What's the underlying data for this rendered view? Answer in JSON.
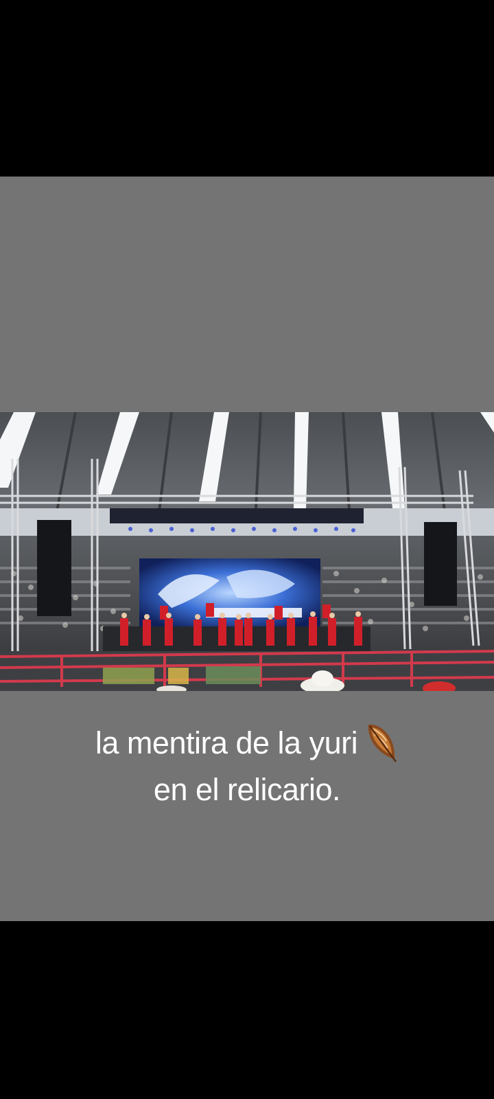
{
  "caption": {
    "line1": "la mentira de la yuri",
    "line2": "en el relicario.",
    "emoji": "feather-icon"
  },
  "colors": {
    "background": "#000000",
    "video_backdrop": "#747474",
    "caption_text": "#ffffff"
  }
}
